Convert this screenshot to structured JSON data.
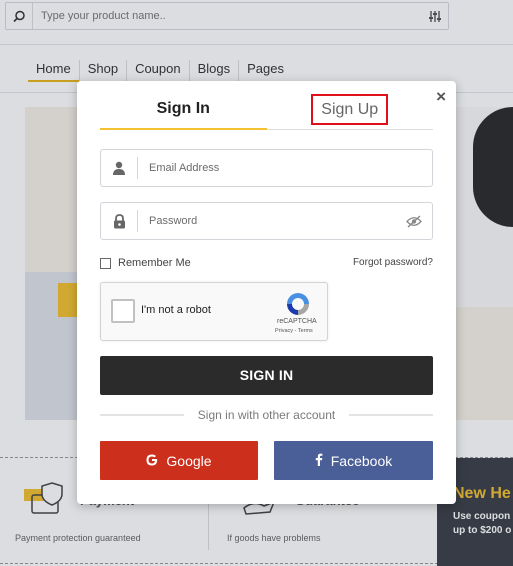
{
  "search": {
    "placeholder": "Type your product name.."
  },
  "nav": {
    "items": [
      "Home",
      "Shop",
      "Coupon",
      "Blogs",
      "Pages"
    ]
  },
  "features": [
    {
      "title": "Payment",
      "text": "Payment protection guaranteed"
    },
    {
      "title": "Guarantee",
      "text": "If goods have problems"
    }
  ],
  "promo": {
    "title": "New He",
    "line1": "Use coupon",
    "line2": "up to $200 o"
  },
  "modal": {
    "close_label": "×",
    "tab_signin": "Sign In",
    "tab_signup": "Sign Up",
    "email_placeholder": "Email Address",
    "password_placeholder": "Password",
    "remember_label": "Remember Me",
    "forgot_label": "Forgot password?",
    "recaptcha_label": "I'm not a robot",
    "recaptcha_brand": "reCAPTCHA",
    "recaptcha_links": "Privacy - Terms",
    "signin_button": "SIGN IN",
    "divider_text": "Sign in with other account",
    "google_label": "Google",
    "facebook_label": "Facebook"
  },
  "colors": {
    "accent": "#f2c230",
    "signin_button": "#2b2b2b",
    "google": "#cc2f1c",
    "facebook": "#4a5e97",
    "highlight_box": "#e0101a"
  }
}
